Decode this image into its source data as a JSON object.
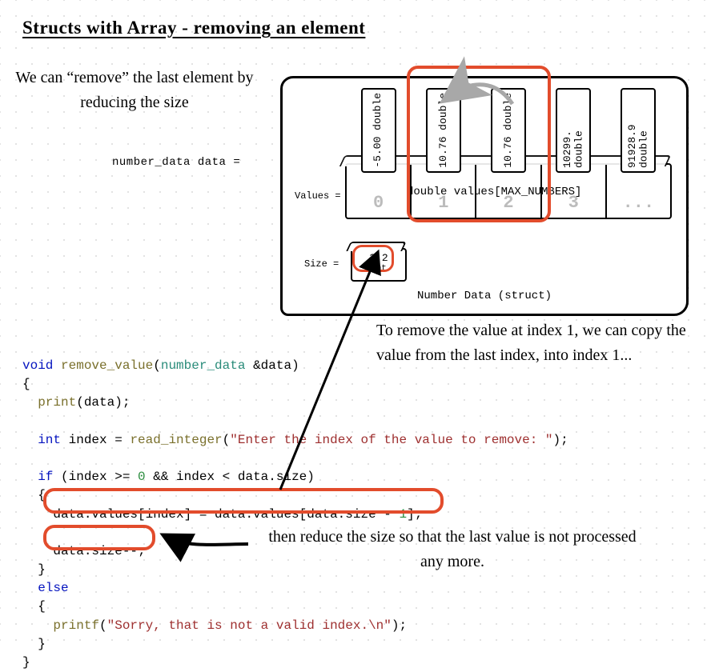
{
  "title": "Structs with Array - removing an element",
  "note_remove_last": "We can “remove” the last element by reducing the size",
  "data_label": "number_data data =",
  "struct": {
    "values_label": "Values =",
    "size_label": "Size =",
    "array_caption": "double values[MAX_NUMBERS]",
    "struct_caption": "Number Data (struct)",
    "slots": [
      {
        "idx": "0",
        "val": "-5.00\ndouble"
      },
      {
        "idx": "1",
        "val": "10.76\ndouble"
      },
      {
        "idx": "2",
        "val": "10.76\ndouble"
      },
      {
        "idx": "3",
        "val": "10299.\ndouble"
      },
      {
        "idx": "...",
        "val": "91928.9\ndouble"
      }
    ],
    "size_old": "3",
    "size_new": "2",
    "size_type": "int"
  },
  "note_copy": "To remove the value at index 1, we can copy the value from the last index, into index 1...",
  "note_reduce": "then reduce the size so that the last value is not processed any more.",
  "code": {
    "fn_sig_void": "void",
    "fn_sig_name": "remove_value",
    "fn_sig_type": "number_data",
    "fn_sig_param": "&data",
    "print_call": "print",
    "print_arg": "(data);",
    "int_kw": "int",
    "index_decl": " index = ",
    "read_call": "read_integer",
    "read_str": "\"Enter the index of the value to remove: \"",
    "if_kw": "if",
    "if_cond_a": " (index >= ",
    "zero": "0",
    "if_cond_b": " && index < data.size)",
    "assign_line": "data.values[index] = data.values[data.size - ",
    "one": "1",
    "assign_end": "];",
    "dec_line": "data.size--;",
    "else_kw": "else",
    "printf_call": "printf",
    "err_str": "\"Sorry, that is not a valid index.\\n\""
  }
}
